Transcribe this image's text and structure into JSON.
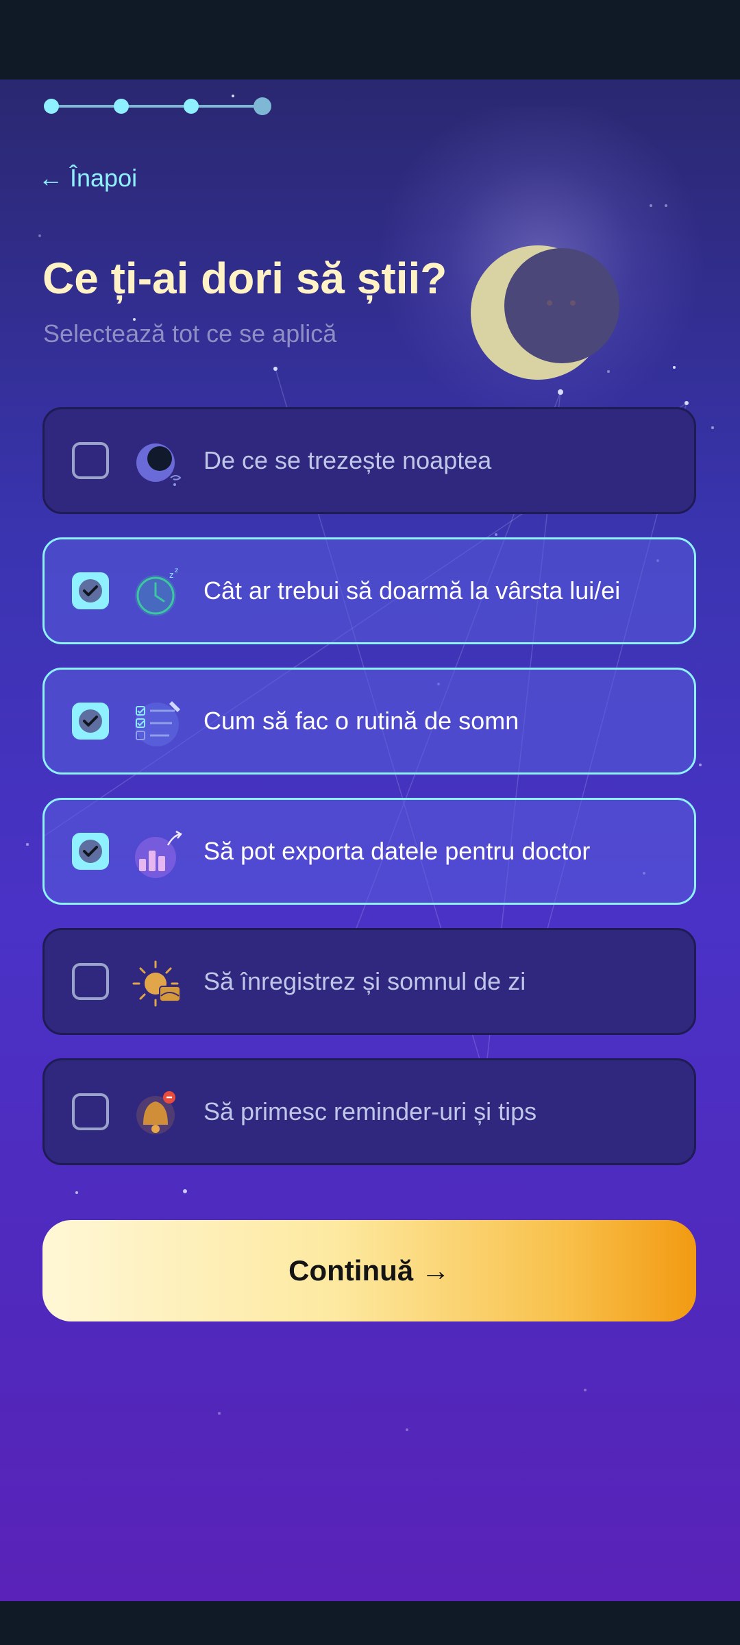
{
  "progress": {
    "total_steps": 4,
    "current_step": 4
  },
  "header": {
    "back_label": "← Înapoi",
    "title": "Ce ți-ai dori să știi?",
    "subtitle": "Selectează tot ce se aplică"
  },
  "options": [
    {
      "label": "De ce se trezește noaptea",
      "checked": false,
      "icon": "moon-icon"
    },
    {
      "label": "Cât ar trebui să doarmă la vârsta lui/ei",
      "checked": true,
      "icon": "clock-sleep-icon"
    },
    {
      "label": "Cum să fac o rutină de somn",
      "checked": true,
      "icon": "checklist-icon"
    },
    {
      "label": "Să pot exporta datele pentru doctor",
      "checked": true,
      "icon": "chart-export-icon"
    },
    {
      "label": "Să înregistrez și somnul de zi",
      "checked": false,
      "icon": "sun-nap-icon"
    },
    {
      "label": "Să primesc reminder-uri și tips",
      "checked": false,
      "icon": "bell-icon"
    }
  ],
  "continue_label": "Continuă →",
  "colors": {
    "accent": "#8ff0ff",
    "title": "#fff2c4",
    "button_gradient_end": "#f29a12",
    "background_top": "#2a2870",
    "background_bottom": "#5a22b8"
  }
}
